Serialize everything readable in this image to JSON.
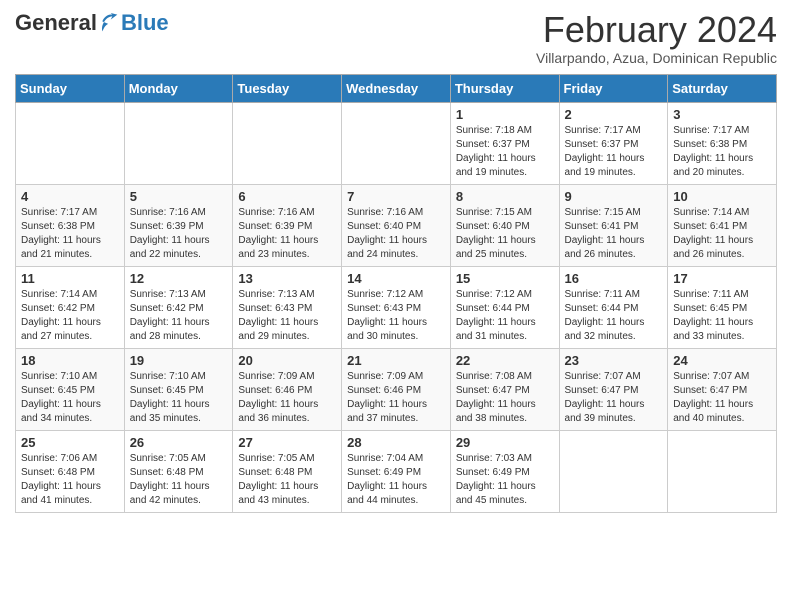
{
  "header": {
    "logo_general": "General",
    "logo_blue": "Blue",
    "month_year": "February 2024",
    "location": "Villarpando, Azua, Dominican Republic"
  },
  "weekdays": [
    "Sunday",
    "Monday",
    "Tuesday",
    "Wednesday",
    "Thursday",
    "Friday",
    "Saturday"
  ],
  "weeks": [
    [
      {
        "day": "",
        "info": ""
      },
      {
        "day": "",
        "info": ""
      },
      {
        "day": "",
        "info": ""
      },
      {
        "day": "",
        "info": ""
      },
      {
        "day": "1",
        "info": "Sunrise: 7:18 AM\nSunset: 6:37 PM\nDaylight: 11 hours\nand 19 minutes."
      },
      {
        "day": "2",
        "info": "Sunrise: 7:17 AM\nSunset: 6:37 PM\nDaylight: 11 hours\nand 19 minutes."
      },
      {
        "day": "3",
        "info": "Sunrise: 7:17 AM\nSunset: 6:38 PM\nDaylight: 11 hours\nand 20 minutes."
      }
    ],
    [
      {
        "day": "4",
        "info": "Sunrise: 7:17 AM\nSunset: 6:38 PM\nDaylight: 11 hours\nand 21 minutes."
      },
      {
        "day": "5",
        "info": "Sunrise: 7:16 AM\nSunset: 6:39 PM\nDaylight: 11 hours\nand 22 minutes."
      },
      {
        "day": "6",
        "info": "Sunrise: 7:16 AM\nSunset: 6:39 PM\nDaylight: 11 hours\nand 23 minutes."
      },
      {
        "day": "7",
        "info": "Sunrise: 7:16 AM\nSunset: 6:40 PM\nDaylight: 11 hours\nand 24 minutes."
      },
      {
        "day": "8",
        "info": "Sunrise: 7:15 AM\nSunset: 6:40 PM\nDaylight: 11 hours\nand 25 minutes."
      },
      {
        "day": "9",
        "info": "Sunrise: 7:15 AM\nSunset: 6:41 PM\nDaylight: 11 hours\nand 26 minutes."
      },
      {
        "day": "10",
        "info": "Sunrise: 7:14 AM\nSunset: 6:41 PM\nDaylight: 11 hours\nand 26 minutes."
      }
    ],
    [
      {
        "day": "11",
        "info": "Sunrise: 7:14 AM\nSunset: 6:42 PM\nDaylight: 11 hours\nand 27 minutes."
      },
      {
        "day": "12",
        "info": "Sunrise: 7:13 AM\nSunset: 6:42 PM\nDaylight: 11 hours\nand 28 minutes."
      },
      {
        "day": "13",
        "info": "Sunrise: 7:13 AM\nSunset: 6:43 PM\nDaylight: 11 hours\nand 29 minutes."
      },
      {
        "day": "14",
        "info": "Sunrise: 7:12 AM\nSunset: 6:43 PM\nDaylight: 11 hours\nand 30 minutes."
      },
      {
        "day": "15",
        "info": "Sunrise: 7:12 AM\nSunset: 6:44 PM\nDaylight: 11 hours\nand 31 minutes."
      },
      {
        "day": "16",
        "info": "Sunrise: 7:11 AM\nSunset: 6:44 PM\nDaylight: 11 hours\nand 32 minutes."
      },
      {
        "day": "17",
        "info": "Sunrise: 7:11 AM\nSunset: 6:45 PM\nDaylight: 11 hours\nand 33 minutes."
      }
    ],
    [
      {
        "day": "18",
        "info": "Sunrise: 7:10 AM\nSunset: 6:45 PM\nDaylight: 11 hours\nand 34 minutes."
      },
      {
        "day": "19",
        "info": "Sunrise: 7:10 AM\nSunset: 6:45 PM\nDaylight: 11 hours\nand 35 minutes."
      },
      {
        "day": "20",
        "info": "Sunrise: 7:09 AM\nSunset: 6:46 PM\nDaylight: 11 hours\nand 36 minutes."
      },
      {
        "day": "21",
        "info": "Sunrise: 7:09 AM\nSunset: 6:46 PM\nDaylight: 11 hours\nand 37 minutes."
      },
      {
        "day": "22",
        "info": "Sunrise: 7:08 AM\nSunset: 6:47 PM\nDaylight: 11 hours\nand 38 minutes."
      },
      {
        "day": "23",
        "info": "Sunrise: 7:07 AM\nSunset: 6:47 PM\nDaylight: 11 hours\nand 39 minutes."
      },
      {
        "day": "24",
        "info": "Sunrise: 7:07 AM\nSunset: 6:47 PM\nDaylight: 11 hours\nand 40 minutes."
      }
    ],
    [
      {
        "day": "25",
        "info": "Sunrise: 7:06 AM\nSunset: 6:48 PM\nDaylight: 11 hours\nand 41 minutes."
      },
      {
        "day": "26",
        "info": "Sunrise: 7:05 AM\nSunset: 6:48 PM\nDaylight: 11 hours\nand 42 minutes."
      },
      {
        "day": "27",
        "info": "Sunrise: 7:05 AM\nSunset: 6:48 PM\nDaylight: 11 hours\nand 43 minutes."
      },
      {
        "day": "28",
        "info": "Sunrise: 7:04 AM\nSunset: 6:49 PM\nDaylight: 11 hours\nand 44 minutes."
      },
      {
        "day": "29",
        "info": "Sunrise: 7:03 AM\nSunset: 6:49 PM\nDaylight: 11 hours\nand 45 minutes."
      },
      {
        "day": "",
        "info": ""
      },
      {
        "day": "",
        "info": ""
      }
    ]
  ]
}
